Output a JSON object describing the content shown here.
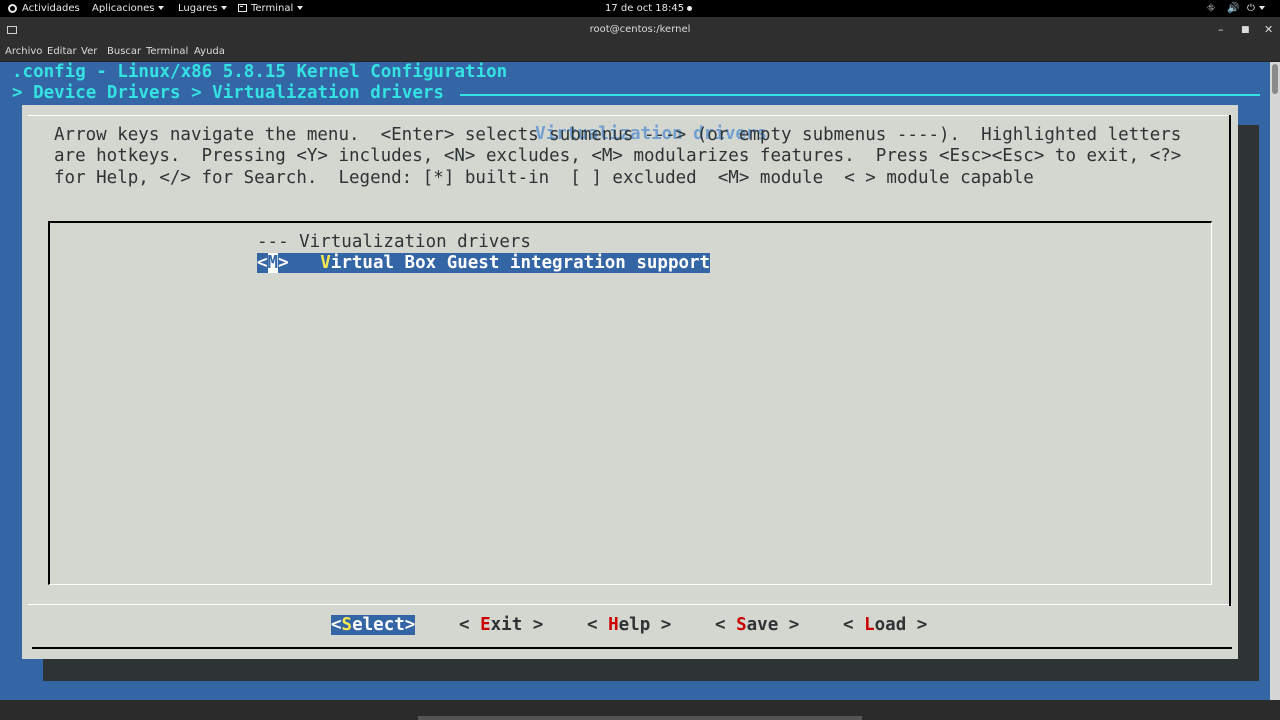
{
  "topbar": {
    "activities": "Actividades",
    "applications": "Aplicaciones",
    "places": "Lugares",
    "terminal": "Terminal",
    "datetime": "17 de oct  18:45"
  },
  "window": {
    "title": "root@centos:/kernel"
  },
  "menubar": {
    "items": [
      "Archivo",
      "Editar",
      "Ver",
      "Buscar",
      "Terminal",
      "Ayuda"
    ]
  },
  "terminal": {
    "header_line1": ".config - Linux/x86 5.8.15 Kernel Configuration",
    "header_line2": "> Device Drivers > Virtualization drivers",
    "dialog_title": "Virtualization drivers",
    "help": [
      "Arrow keys navigate the menu.  <Enter> selects submenus ---> (or empty submenus ----).  Highlighted letters",
      "are hotkeys.  Pressing <Y> includes, <N> excludes, <M> modularizes features.  Press <Esc><Esc> to exit, <?>",
      "for Help, </> for Search.  Legend: [*] built-in  [ ] excluded  <M> module  < > module capable"
    ],
    "menu_header": "--- Virtualization drivers",
    "selected_item": {
      "prefix_open": "<",
      "prefix_value": "M",
      "prefix_close": ">   ",
      "hotkey": "V",
      "label_rest": "irtual Box Guest integration support"
    },
    "buttons": {
      "select": {
        "open": "<",
        "hot": "S",
        "rest": "elect>"
      },
      "exit": {
        "open": "< ",
        "hot": "E",
        "rest": "xit >"
      },
      "help": {
        "open": "< ",
        "hot": "H",
        "rest": "elp >"
      },
      "save": {
        "open": "< ",
        "hot": "S",
        "rest": "ave >"
      },
      "load": {
        "open": "< ",
        "hot": "L",
        "rest": "oad >"
      }
    }
  }
}
